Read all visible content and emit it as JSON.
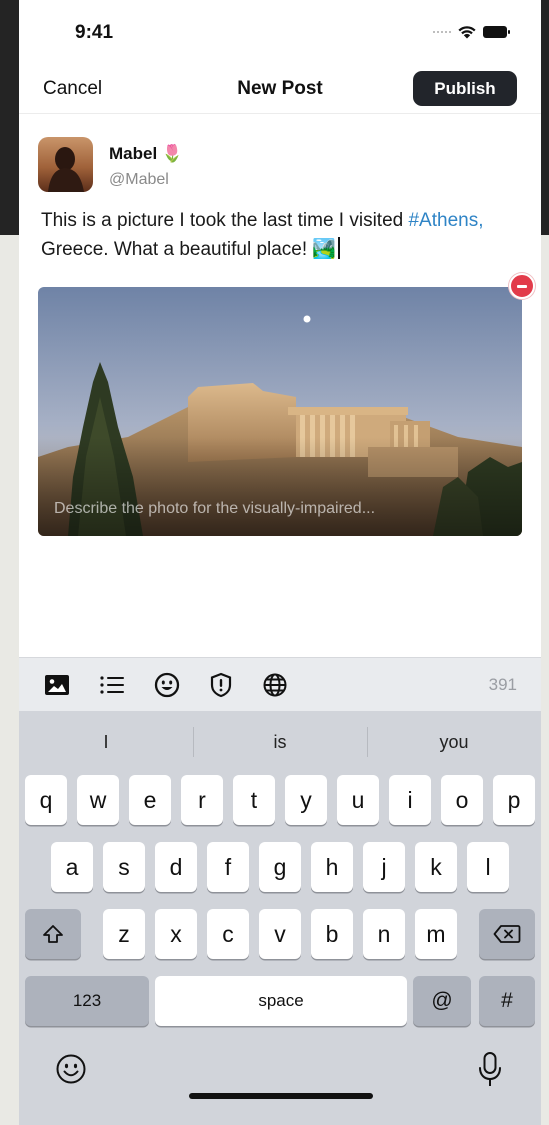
{
  "status_bar": {
    "time": "9:41"
  },
  "nav": {
    "cancel_label": "Cancel",
    "title": "New Post",
    "publish_label": "Publish"
  },
  "author": {
    "name": "Mabel 🌷",
    "handle": "@Mabel"
  },
  "post": {
    "text_before": "This is a picture I took the last time I visited ",
    "hashtag": "#Athens,",
    "text_after": " Greece. What a beautiful place! 🏞️"
  },
  "photo": {
    "alt_placeholder": "Describe the photo for the visually-impaired..."
  },
  "toolbar": {
    "icons": [
      "image-icon",
      "list-icon",
      "emoji-icon",
      "content-warning-icon",
      "globe-icon"
    ],
    "char_count": "391"
  },
  "keyboard": {
    "suggestions": [
      "I",
      "is",
      "you"
    ],
    "row1": [
      "q",
      "w",
      "e",
      "r",
      "t",
      "y",
      "u",
      "i",
      "o",
      "p"
    ],
    "row2": [
      "a",
      "s",
      "d",
      "f",
      "g",
      "h",
      "j",
      "k",
      "l"
    ],
    "row3": [
      "z",
      "x",
      "c",
      "v",
      "b",
      "n",
      "m"
    ],
    "numbers_label": "123",
    "space_label": "space",
    "at_label": "@",
    "hash_label": "#"
  },
  "colors": {
    "hashtag": "#2f84c6",
    "publish_bg": "#22252b",
    "remove": "#e23b4a"
  }
}
